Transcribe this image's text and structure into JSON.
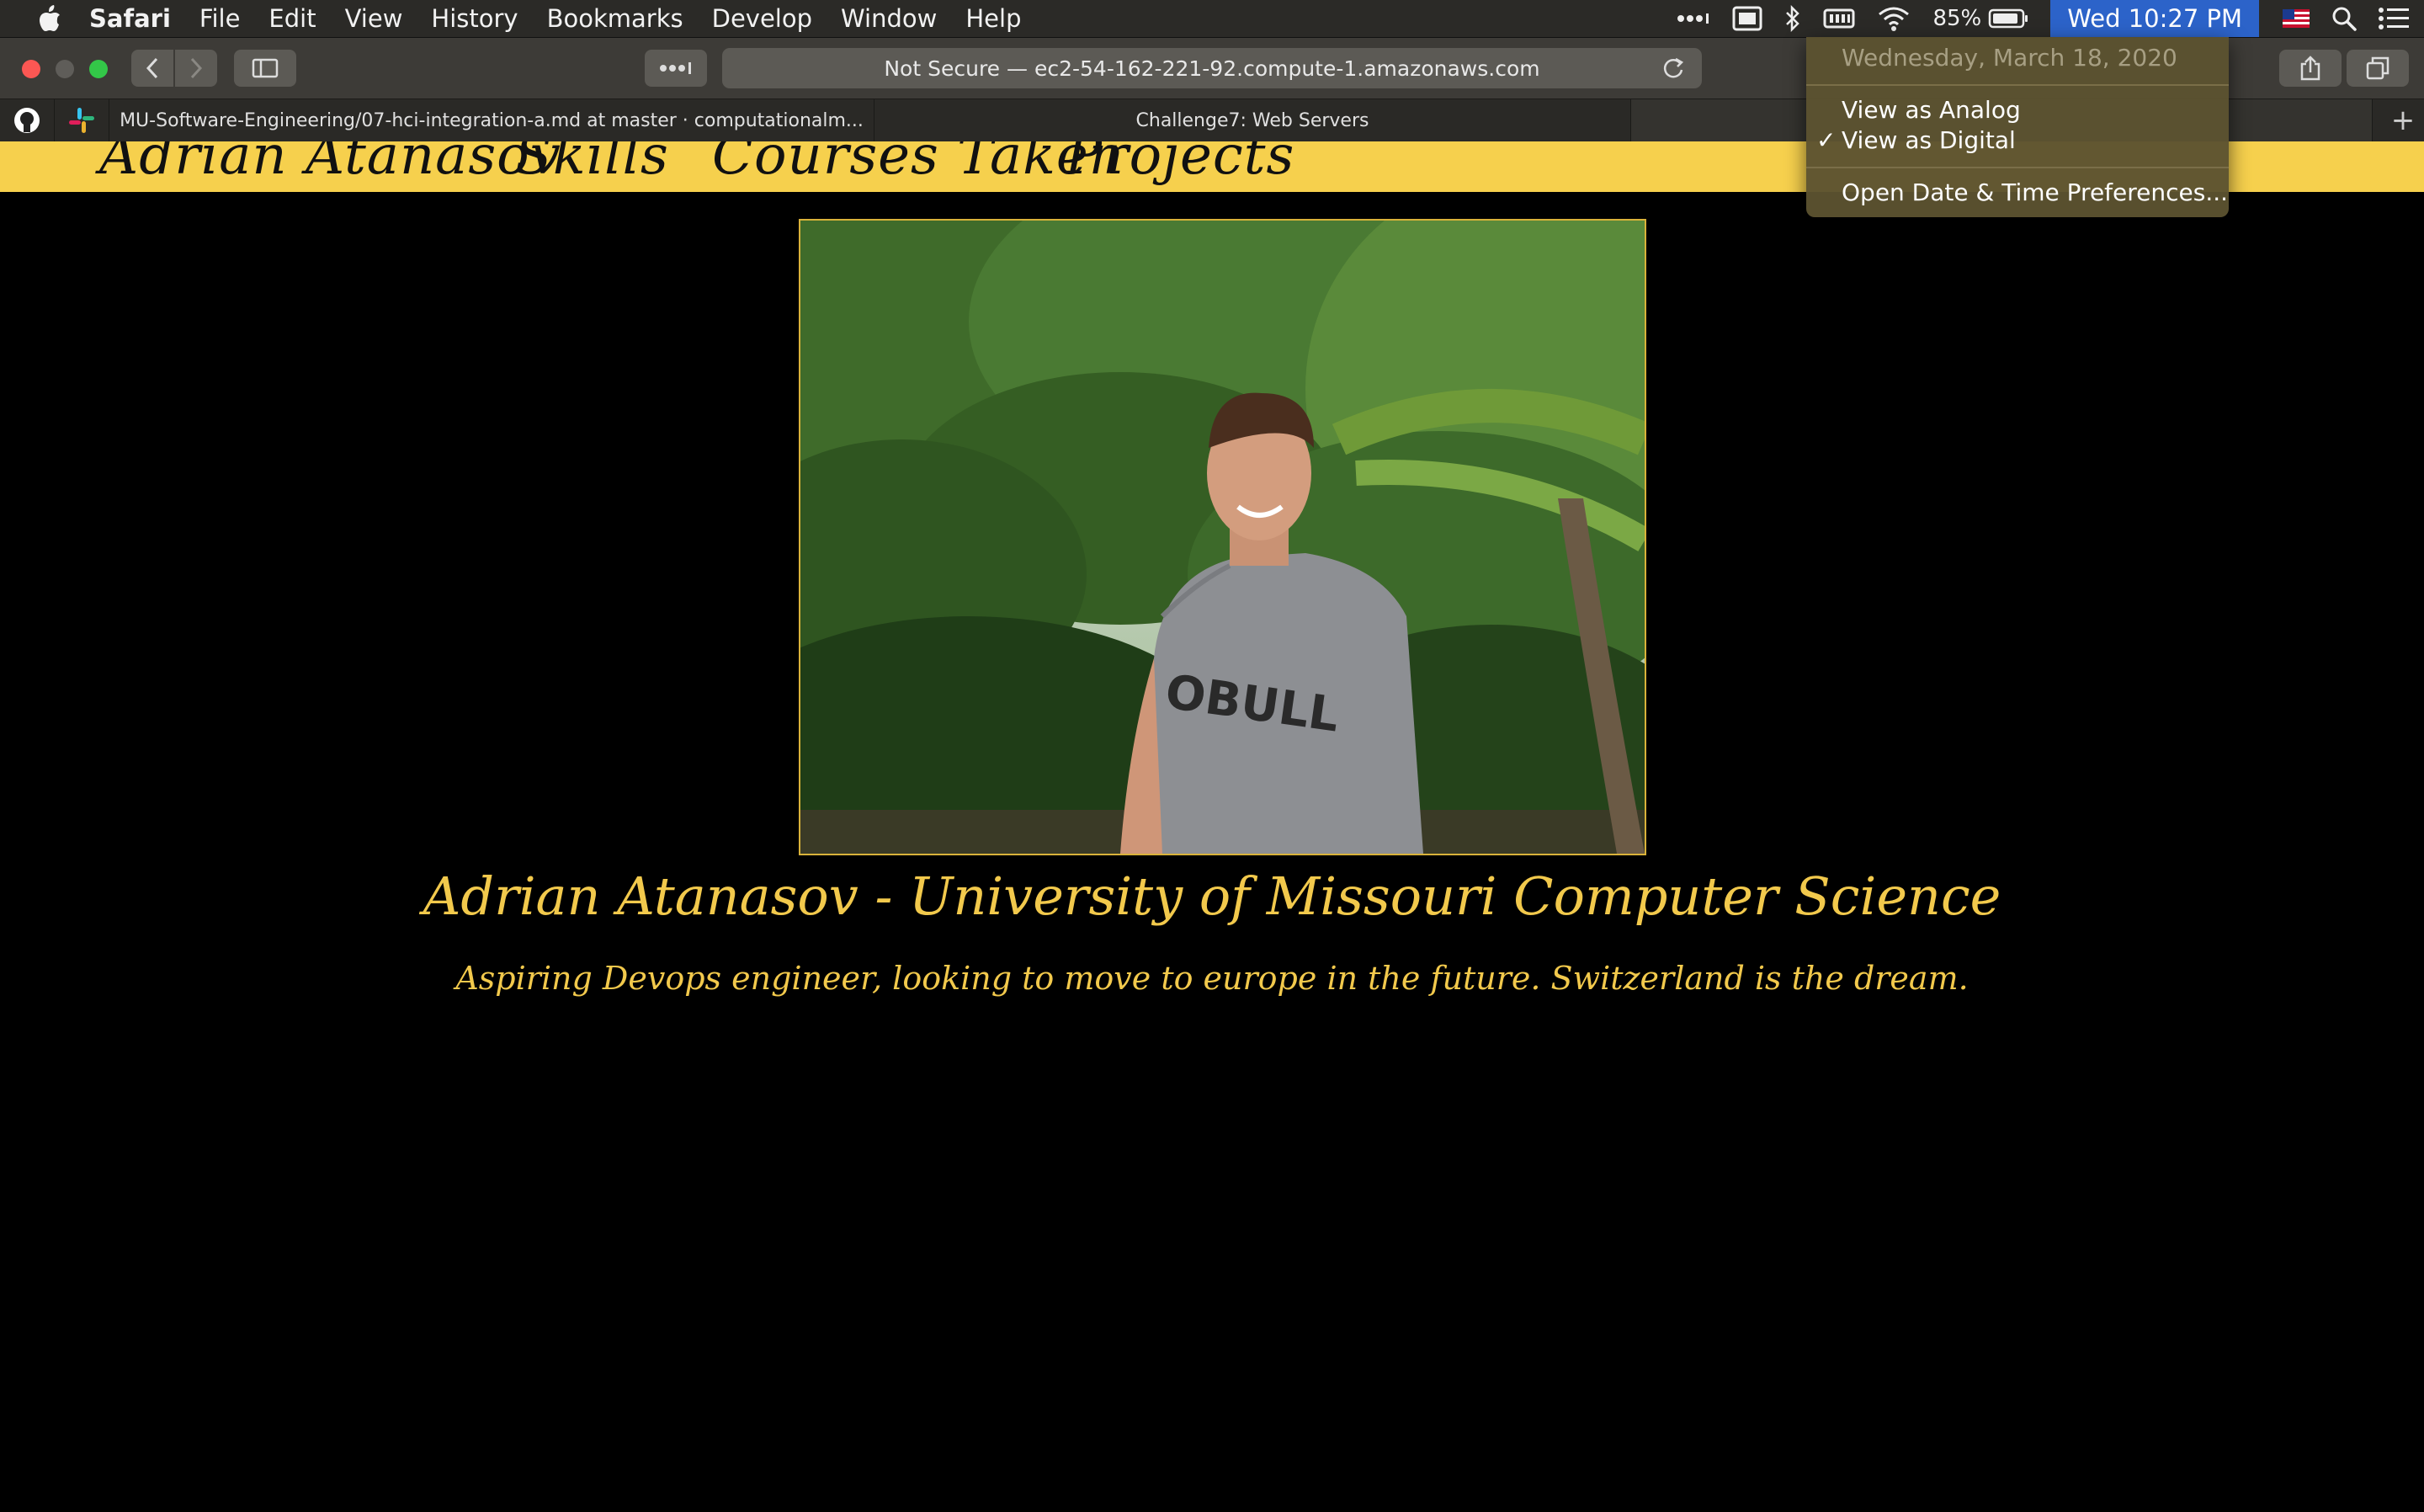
{
  "menubar": {
    "app_name": "Safari",
    "items": [
      "File",
      "Edit",
      "View",
      "History",
      "Bookmarks",
      "Develop",
      "Window",
      "Help"
    ],
    "battery_percent": "85%",
    "clock": "Wed 10:27 PM"
  },
  "toolbar": {
    "address": "Not Secure — ec2-54-162-221-92.compute-1.amazonaws.com"
  },
  "tabs": [
    {
      "title": "MU-Software-Engineering/07-hci-integration-a.md at master · computationalm..."
    },
    {
      "title": "Challenge7: Web Servers"
    }
  ],
  "site": {
    "nav": [
      "Adrian Atanasov",
      "Skills",
      "Courses Taken",
      "Projects"
    ],
    "title": "Adrian Atanasov - University of Missouri Computer Science",
    "subtitle": "Aspiring Devops engineer, looking to move to europe in the future. Switzerland is the dream."
  },
  "clock_menu": {
    "date": "Wednesday, March 18, 2020",
    "analog": "View as Analog",
    "digital": "View as Digital",
    "check": "✓",
    "preferences": "Open Date & Time Preferences..."
  },
  "colors": {
    "nav_bar": "#f6d04d",
    "gold_text": "#f2c94c",
    "clock_highlight": "#2c63c9"
  }
}
